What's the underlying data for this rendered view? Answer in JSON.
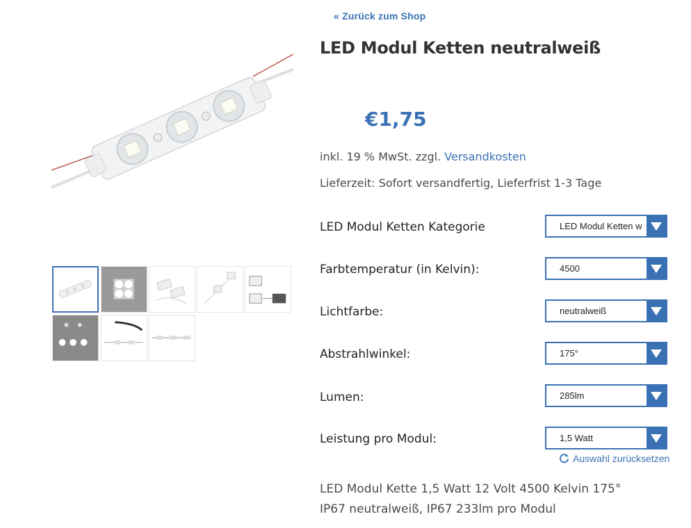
{
  "nav": {
    "back_label": "« Zurück zum Shop"
  },
  "product": {
    "title": "LED Modul Ketten neutralweiß",
    "price": "€1,75",
    "tax_text": "inkl. 19 % MwSt. zzgl. ",
    "shipping_link": "Versandkosten",
    "delivery": "Lieferzeit: Sofort versandfertig, Lieferfrist 1-3 Tage",
    "description": "LED Modul Kette 1,5 Watt 12 Volt 4500 Kelvin 175° IP67 neutralweiß, IP67 233lm pro Modul"
  },
  "gallery": {
    "main_image_icon": "led-module-chain-image",
    "thumb_count": 8,
    "active_thumb": 1
  },
  "variations": [
    {
      "label": "LED Modul Ketten Kategorie",
      "value": "LED Modul Ketten w"
    },
    {
      "label": "Farbtemperatur (in Kelvin):",
      "value": "4500"
    },
    {
      "label": "Lichtfarbe:",
      "value": "neutralweiß"
    },
    {
      "label": "Abstrahlwinkel:",
      "value": "175°"
    },
    {
      "label": "Lumen:",
      "value": "285lm"
    },
    {
      "label": "Leistung pro Modul:",
      "value": "1,5 Watt"
    }
  ],
  "reset": {
    "label": "Auswahl zurücksetzen",
    "icon": "refresh-icon"
  },
  "colors": {
    "accent": "#3a71b4",
    "text": "#333333"
  }
}
